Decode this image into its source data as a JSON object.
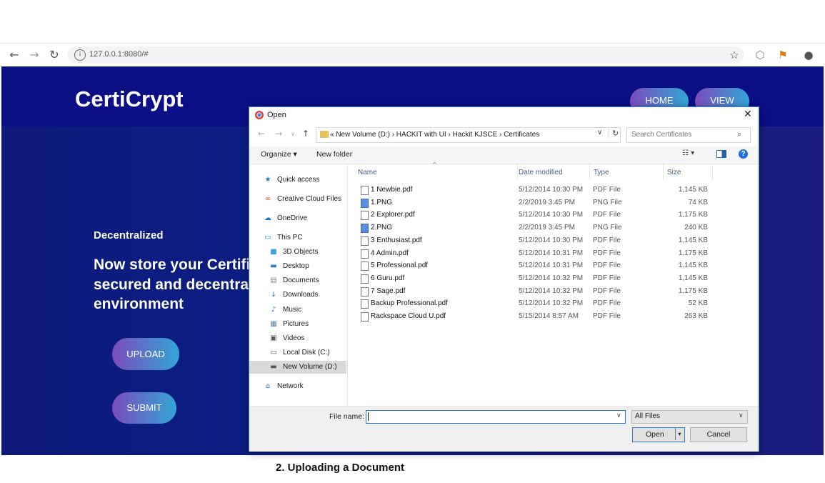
{
  "browser": {
    "url": "127.0.0.1:8080/#",
    "badge_count": "1"
  },
  "site": {
    "brand": "CertiCrypt",
    "nav": [
      {
        "label": "HOME"
      },
      {
        "label": "VIEW"
      }
    ],
    "hero_kicker": "Decentralized",
    "hero_title": "Now store your Certificates in a secured and decentralized environment",
    "upload_label": "UPLOAD",
    "submit_label": "SUBMIT"
  },
  "dialog": {
    "title": "Open",
    "address_path": "« New Volume (D:) › HACKIT with UI › Hackit KJSCE › Certificates",
    "search_placeholder": "Search Certificates",
    "organize_label": "Organize ▾",
    "new_folder_label": "New folder",
    "nav_items": [
      {
        "label": "Quick access",
        "icon": "star-icon",
        "glyph": "★",
        "color": "#2a78d6"
      },
      {
        "label": "Creative Cloud Files",
        "icon": "creative-cloud-icon",
        "glyph": "∞",
        "color": "#e8502a"
      },
      {
        "label": "OneDrive",
        "icon": "cloud-icon",
        "glyph": "☁",
        "color": "#1e6fd9"
      },
      {
        "label": "This PC",
        "icon": "computer-icon",
        "glyph": "▭",
        "color": "#3a8ee6"
      },
      {
        "label": "3D Objects",
        "icon": "cube-icon",
        "glyph": "■",
        "color": "#3aa7e0"
      },
      {
        "label": "Desktop",
        "icon": "desktop-icon",
        "glyph": "▬",
        "color": "#2a78d6"
      },
      {
        "label": "Documents",
        "icon": "document-icon",
        "glyph": "▤",
        "color": "#888888"
      },
      {
        "label": "Downloads",
        "icon": "download-icon",
        "glyph": "↓",
        "color": "#2a78d6"
      },
      {
        "label": "Music",
        "icon": "music-icon",
        "glyph": "♪",
        "color": "#2a78d6"
      },
      {
        "label": "Pictures",
        "icon": "pictures-icon",
        "glyph": "▦",
        "color": "#5a7fa8"
      },
      {
        "label": "Videos",
        "icon": "videos-icon",
        "glyph": "▣",
        "color": "#555555"
      },
      {
        "label": "Local Disk (C:)",
        "icon": "disk-icon",
        "glyph": "▭",
        "color": "#555555"
      },
      {
        "label": "New Volume (D:)",
        "icon": "drive-icon",
        "glyph": "▬",
        "color": "#555555"
      },
      {
        "label": "Network",
        "icon": "network-icon",
        "glyph": "⌂",
        "color": "#2a78d6"
      }
    ],
    "columns": [
      "Name",
      "Date modified",
      "Type",
      "Size"
    ],
    "files": [
      {
        "name": "1 Newbie.pdf",
        "date": "5/12/2014 10:30 PM",
        "type": "PDF File",
        "size": "1,145 KB",
        "kind": "pdf"
      },
      {
        "name": "1.PNG",
        "date": "2/2/2019 3:45 PM",
        "type": "PNG File",
        "size": "74 KB",
        "kind": "png"
      },
      {
        "name": "2 Explorer.pdf",
        "date": "5/12/2014 10:30 PM",
        "type": "PDF File",
        "size": "1,175 KB",
        "kind": "pdf"
      },
      {
        "name": "2.PNG",
        "date": "2/2/2019 3:45 PM",
        "type": "PNG File",
        "size": "240 KB",
        "kind": "png"
      },
      {
        "name": "3 Enthusiast.pdf",
        "date": "5/12/2014 10:30 PM",
        "type": "PDF File",
        "size": "1,145 KB",
        "kind": "pdf"
      },
      {
        "name": "4 Admin.pdf",
        "date": "5/12/2014 10:31 PM",
        "type": "PDF File",
        "size": "1,175 KB",
        "kind": "pdf"
      },
      {
        "name": "5 Professional.pdf",
        "date": "5/12/2014 10:31 PM",
        "type": "PDF File",
        "size": "1,145 KB",
        "kind": "pdf"
      },
      {
        "name": "6 Guru.pdf",
        "date": "5/12/2014 10:32 PM",
        "type": "PDF File",
        "size": "1,145 KB",
        "kind": "pdf"
      },
      {
        "name": "7 Sage.pdf",
        "date": "5/12/2014 10:32 PM",
        "type": "PDF File",
        "size": "1,175 KB",
        "kind": "pdf"
      },
      {
        "name": "Backup Professional.pdf",
        "date": "5/12/2014 10:32 PM",
        "type": "PDF File",
        "size": "52 KB",
        "kind": "pdf"
      },
      {
        "name": "Rackspace Cloud U.pdf",
        "date": "5/15/2014 8:57 AM",
        "type": "PDF File",
        "size": "263 KB",
        "kind": "pdf"
      }
    ],
    "filename_label": "File name:",
    "filename_value": "",
    "filetype_value": "All Files",
    "open_label": "Open",
    "cancel_label": "Cancel"
  },
  "caption": "2. Uploading a Document"
}
